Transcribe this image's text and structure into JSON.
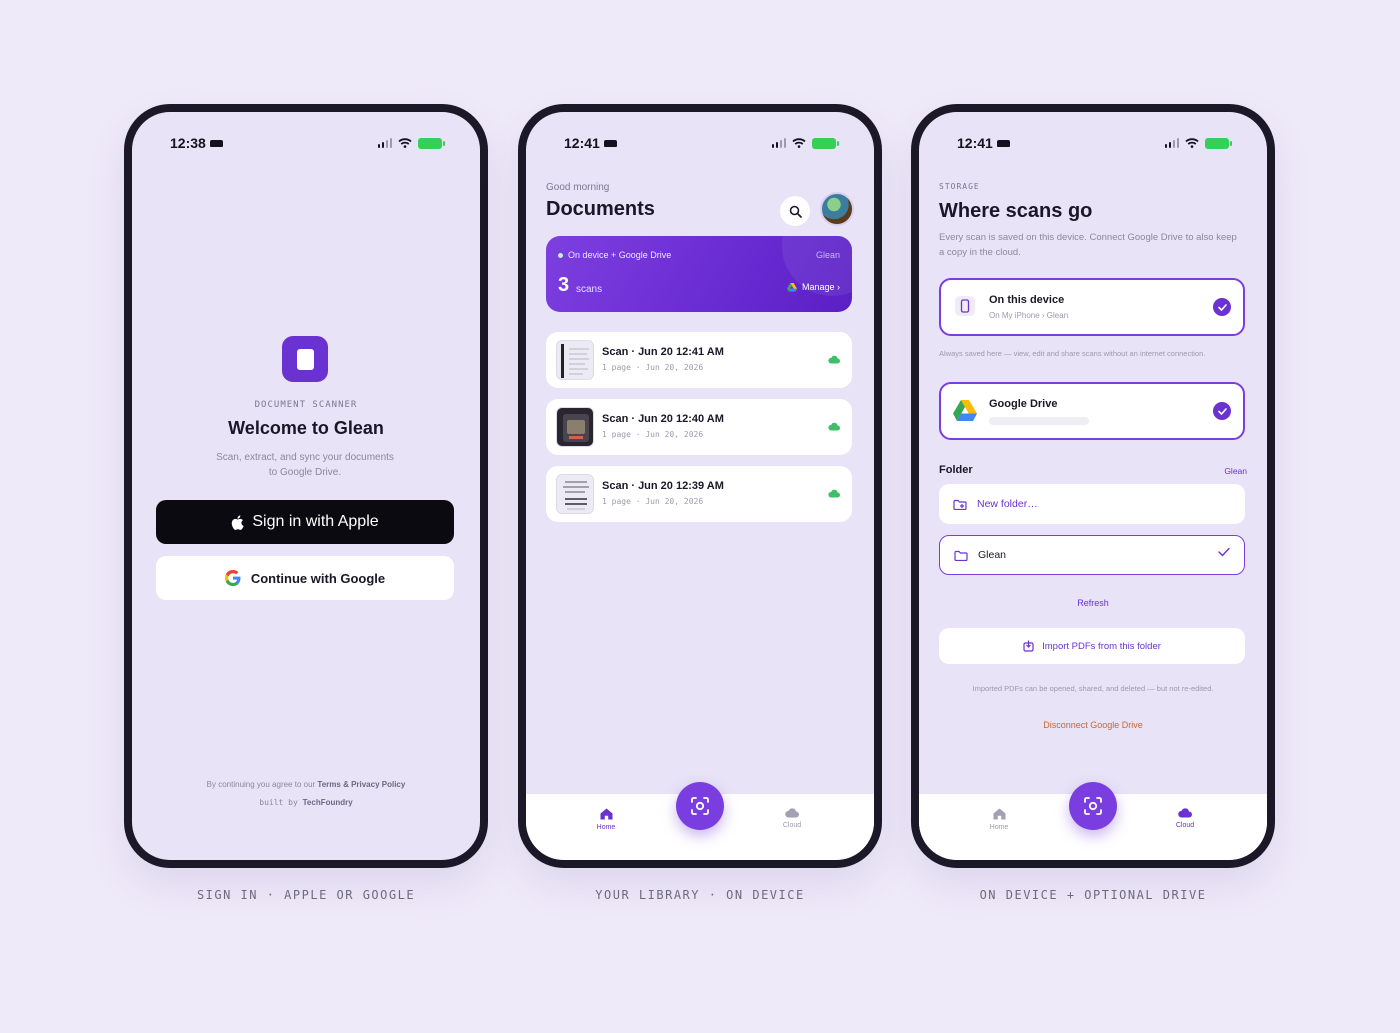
{
  "screens": [
    {
      "status": {
        "time": "12:38"
      },
      "app": {
        "kicker": "DOCUMENT SCANNER",
        "title": "Welcome to Glean",
        "subtitle": "Scan, extract, and sync your documents to Google Drive."
      },
      "buttons": {
        "apple": "Sign in with Apple",
        "google": "Continue with Google"
      },
      "legal": {
        "prefix": "By continuing you agree to our ",
        "link": "Terms & Privacy Policy"
      },
      "built": {
        "prefix": "built by ",
        "brand": "TechFoundry"
      },
      "caption": "SIGN IN · APPLE OR GOOGLE"
    },
    {
      "status": {
        "time": "12:41"
      },
      "greeting": "Good morning",
      "title": "Documents",
      "summary": {
        "location": "On device + Google Drive",
        "folder": "Glean",
        "count": "3",
        "unit": "scans",
        "manage": "Manage ›"
      },
      "scans": [
        {
          "title": "Scan · Jun 20 12:41 AM",
          "meta": "1 page · Jun 20, 2026"
        },
        {
          "title": "Scan · Jun 20 12:40 AM",
          "meta": "1 page · Jun 20, 2026"
        },
        {
          "title": "Scan · Jun 20 12:39 AM",
          "meta": "1 page · Jun 20, 2026"
        }
      ],
      "tabs": {
        "home": "Home",
        "cloud": "Cloud"
      },
      "caption": "YOUR LIBRARY · ON DEVICE"
    },
    {
      "status": {
        "time": "12:41"
      },
      "kicker": "STORAGE",
      "title": "Where scans go",
      "description": "Every scan is saved on this device. Connect Google Drive to also keep a copy in the cloud.",
      "device_option": {
        "title": "On this device",
        "meta": "On My iPhone › Glean"
      },
      "device_note": "Always saved here — view, edit and share scans without an internet connection.",
      "drive_option": {
        "title": "Google Drive"
      },
      "folder_label": "Folder",
      "folder_link": "Glean",
      "new_folder": "New folder…",
      "folder_selected": "Glean",
      "refresh": "Refresh",
      "import": "Import PDFs from this folder",
      "import_note": "Imported PDFs can be opened, shared, and deleted — but not re-edited.",
      "disconnect": "Disconnect Google Drive",
      "tabs": {
        "home": "Home",
        "cloud": "Cloud"
      },
      "caption": "ON DEVICE + OPTIONAL DRIVE"
    }
  ],
  "colors": {
    "background": "#efeaf9",
    "accent": "#6a32d1",
    "screen": "#e8e3f7",
    "battery": "#34d058",
    "disconnect": "#c9662e"
  }
}
